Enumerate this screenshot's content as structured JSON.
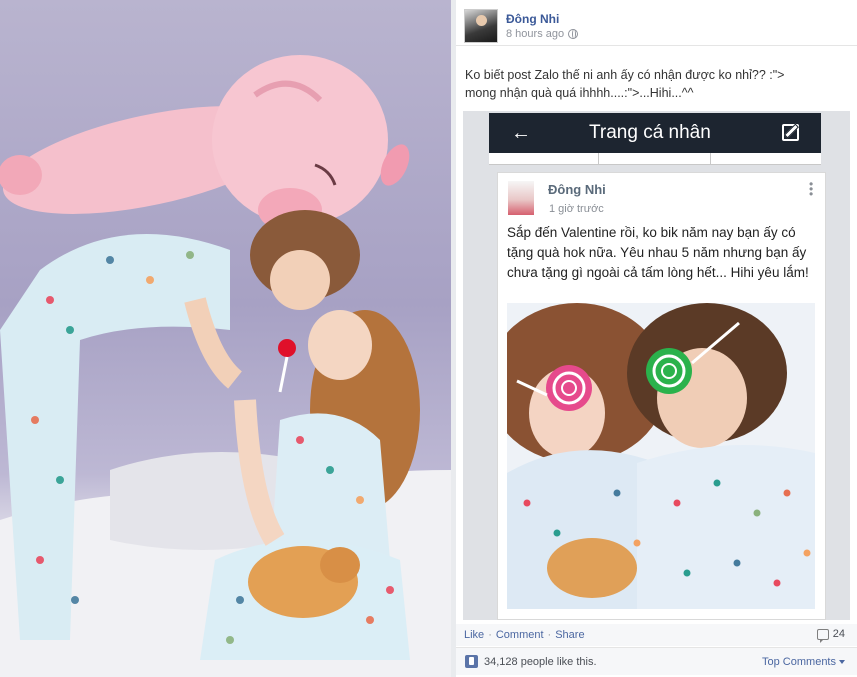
{
  "post": {
    "author": "Đông Nhi",
    "timestamp": "8 hours ago",
    "caption_line1": "Ko biết post Zalo thế ni anh ấy có nhận được ko nhỉ?? :\">",
    "caption_line2": "mong nhận quà quá ihhhh....:\">...Hihi...^^"
  },
  "phone": {
    "title": "Trang cá nhân",
    "post_author": "Đông Nhi",
    "post_time": "1 giờ trước",
    "post_text": "Sắp đến Valentine rồi, ko bik năm nay bạn ấy có tặng quà hok nữa. Yêu nhau 5 năm nhưng bạn ấy chưa tặng gì ngoài cả tấm lòng hết... Hihi yêu lắm!"
  },
  "actions": {
    "like": "Like",
    "comment": "Comment",
    "share": "Share",
    "comment_count": "24"
  },
  "likes": {
    "text": "34,128 people like this.",
    "top_comments": "Top Comments"
  },
  "colors": {
    "facebook_blue": "#3b5998",
    "link_blue": "#4b67a1",
    "phone_bar": "#1d2530"
  }
}
